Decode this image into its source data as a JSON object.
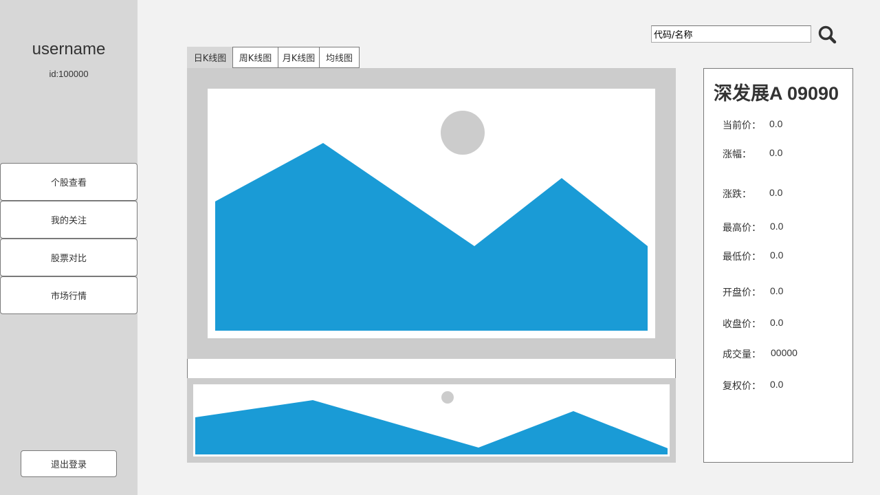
{
  "sidebar": {
    "username": "username",
    "user_id": "id:100000",
    "nav_items": [
      {
        "label": "个股查看"
      },
      {
        "label": "我的关注"
      },
      {
        "label": "股票对比"
      },
      {
        "label": "市场行情"
      }
    ],
    "logout_label": "退出登录"
  },
  "search": {
    "value": "代码/名称",
    "icon": "search-icon"
  },
  "tabs": [
    {
      "label": "日K线图",
      "active": true
    },
    {
      "label": "周K线图",
      "active": false
    },
    {
      "label": "月K线图",
      "active": false
    },
    {
      "label": "均线图",
      "active": false
    }
  ],
  "chart_placeholder": {
    "icon": "image-placeholder-icon",
    "frame_color": "#cccccc",
    "mountain_color": "#1a9bd6",
    "sun_color": "#cccccc"
  },
  "stock": {
    "name": "深发展A 09090",
    "fields": [
      {
        "label": "当前价：",
        "value": "0.0"
      },
      {
        "label": "涨幅：",
        "value": "0.0"
      },
      {
        "label": "涨跌：",
        "value": "0.0"
      },
      {
        "label": "最高价：",
        "value": "0.0"
      },
      {
        "label": "最低价：",
        "value": "0.0"
      },
      {
        "label": "开盘价：",
        "value": "0.0"
      },
      {
        "label": "收盘价：",
        "value": "0.0"
      },
      {
        "label": "成交量：",
        "value": "00000"
      },
      {
        "label": "复权价：",
        "value": "0.0"
      }
    ]
  }
}
